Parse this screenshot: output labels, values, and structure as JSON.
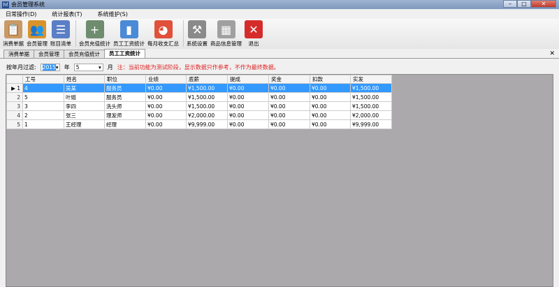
{
  "window": {
    "title": "会员管理系统",
    "app_icon": "hf"
  },
  "menu": [
    "日常操作(D)",
    "统计报表(T)",
    "系统维护(S)"
  ],
  "toolbar": [
    {
      "label": "消费单据",
      "icon": "clipboard-icon",
      "color": "#c89a68"
    },
    {
      "label": "会员管理",
      "icon": "users-icon",
      "color": "#d8932c"
    },
    {
      "label": "账目清单",
      "icon": "list-icon",
      "color": "#5b7fc6"
    },
    {
      "label": "会员充值统计",
      "icon": "database-add-icon",
      "color": "#6f8c6f"
    },
    {
      "label": "员工工资统计",
      "icon": "bar-chart-icon",
      "color": "#4a8ad6"
    },
    {
      "label": "每月收支汇总",
      "icon": "pie-chart-icon",
      "color": "#e0503a"
    },
    {
      "label": "系统设置",
      "icon": "tools-icon",
      "color": "#8a8a8a"
    },
    {
      "label": "商品信息管理",
      "icon": "grid-icon",
      "color": "#a0a0a0"
    },
    {
      "label": "退出",
      "icon": "exit-icon",
      "color": "#d62b2b"
    }
  ],
  "tabs": [
    "消费单据",
    "会员管理",
    "会员充值统计",
    "员工工资统计"
  ],
  "active_tab": 3,
  "filter": {
    "label": "按年月过滤:",
    "year": "2015",
    "year_unit": "年",
    "month": "5",
    "month_unit": "月",
    "note": "注：当前功能为测试阶段，显示数据只作参考，不作为最终数据。"
  },
  "grid": {
    "columns": [
      "工号",
      "姓名",
      "职位",
      "业绩",
      "底薪",
      "提成",
      "奖金",
      "扣款",
      "实发"
    ],
    "rows": [
      [
        "1",
        "4",
        "吴某",
        "服务员",
        "¥0.00",
        "¥1,500.00",
        "¥0.00",
        "¥0.00",
        "¥0.00",
        "¥1,500.00"
      ],
      [
        "2",
        "5",
        "叶姐",
        "服务员",
        "¥0.00",
        "¥1,500.00",
        "¥0.00",
        "¥0.00",
        "¥0.00",
        "¥1,500.00"
      ],
      [
        "3",
        "3",
        "李四",
        "洗头师",
        "¥0.00",
        "¥1,500.00",
        "¥0.00",
        "¥0.00",
        "¥0.00",
        "¥1,500.00"
      ],
      [
        "4",
        "2",
        "张三",
        "理发师",
        "¥0.00",
        "¥2,000.00",
        "¥0.00",
        "¥0.00",
        "¥0.00",
        "¥2,000.00"
      ],
      [
        "5",
        "1",
        "王经理",
        "经理",
        "¥0.00",
        "¥9,999.00",
        "¥0.00",
        "¥0.00",
        "¥0.00",
        "¥9,999.00"
      ]
    ],
    "selected_row": 0
  }
}
